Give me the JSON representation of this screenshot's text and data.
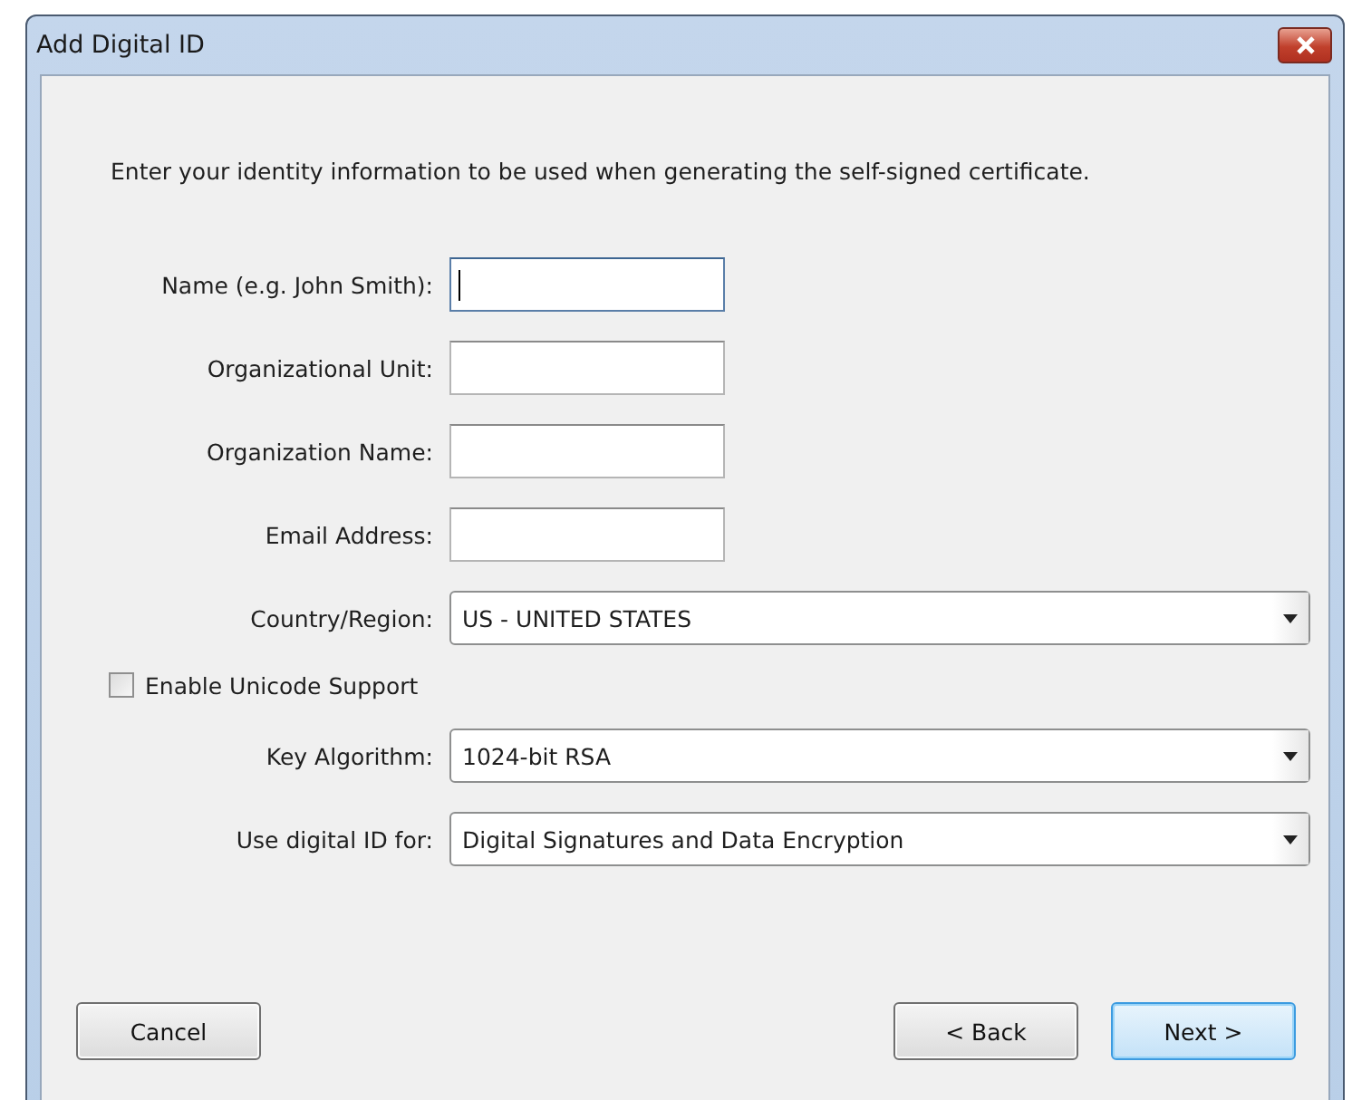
{
  "window": {
    "title": "Add Digital ID"
  },
  "description": "Enter your identity information to be used when generating the self-signed certificate.",
  "fields": [
    {
      "kind": "text",
      "label": "Name (e.g. John Smith):",
      "focused": true
    },
    {
      "kind": "text",
      "label": "Organizational Unit:",
      "focused": false
    },
    {
      "kind": "text",
      "label": "Organization Name:",
      "focused": false
    },
    {
      "kind": "text",
      "label": "Email Address:",
      "focused": false
    },
    {
      "kind": "select",
      "label": "Country/Region:",
      "value": "US - UNITED STATES"
    },
    {
      "kind": "checkbox",
      "label": "Enable Unicode Support",
      "checked": false
    },
    {
      "kind": "select",
      "label": "Key Algorithm:",
      "value": "1024-bit RSA"
    },
    {
      "kind": "select",
      "label": "Use digital ID for:",
      "value": "Digital Signatures and Data Encryption"
    }
  ],
  "buttons_left": [
    {
      "label": "Cancel",
      "default": false
    }
  ],
  "buttons_right": [
    {
      "label": "< Back",
      "default": false
    },
    {
      "label": "Next >",
      "default": true
    }
  ]
}
